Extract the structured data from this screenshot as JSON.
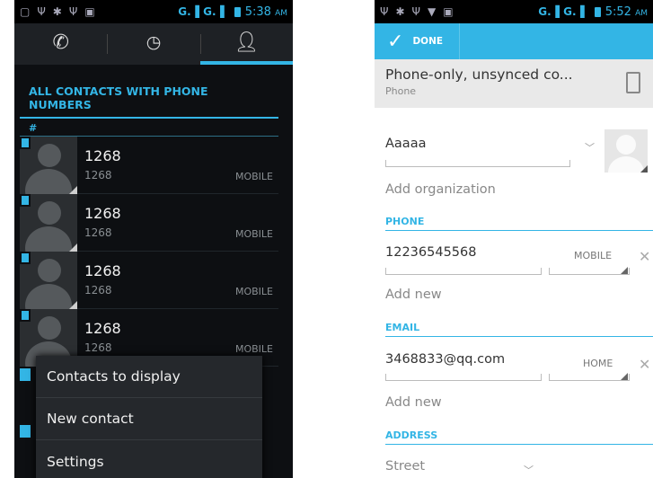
{
  "left": {
    "status": {
      "signal": "G.▐ G.▐",
      "time": "5:38",
      "ampm": "AM"
    },
    "section_title": "ALL CONTACTS WITH PHONE NUMBERS",
    "index_letter": "#",
    "contacts": [
      {
        "name": "1268",
        "number": "1268",
        "type": "MOBILE"
      },
      {
        "name": "1268",
        "number": "1268",
        "type": "MOBILE"
      },
      {
        "name": "1268",
        "number": "1268",
        "type": "MOBILE"
      },
      {
        "name": "1268",
        "number": "1268",
        "type": "MOBILE"
      }
    ],
    "menu": [
      "Contacts to display",
      "New contact",
      "Settings"
    ]
  },
  "right": {
    "status": {
      "signal": "G.▐ G.▐",
      "time": "5:52",
      "ampm": "AM"
    },
    "done_label": "DONE",
    "account_title": "Phone-only, unsynced co...",
    "account_subtitle": "Phone",
    "name_value": "Aaaaa",
    "org_hint": "Add organization",
    "phone_label": "PHONE",
    "phone_value": "12236545568",
    "phone_type": "MOBILE",
    "phone_add": "Add new",
    "email_label": "EMAIL",
    "email_value": "3468833@qq.com",
    "email_type": "HOME",
    "email_add": "Add new",
    "address_label": "ADDRESS",
    "street_hint": "Street"
  },
  "colors": {
    "accent": "#33b5e5",
    "dark_bg": "#0d0f12"
  }
}
